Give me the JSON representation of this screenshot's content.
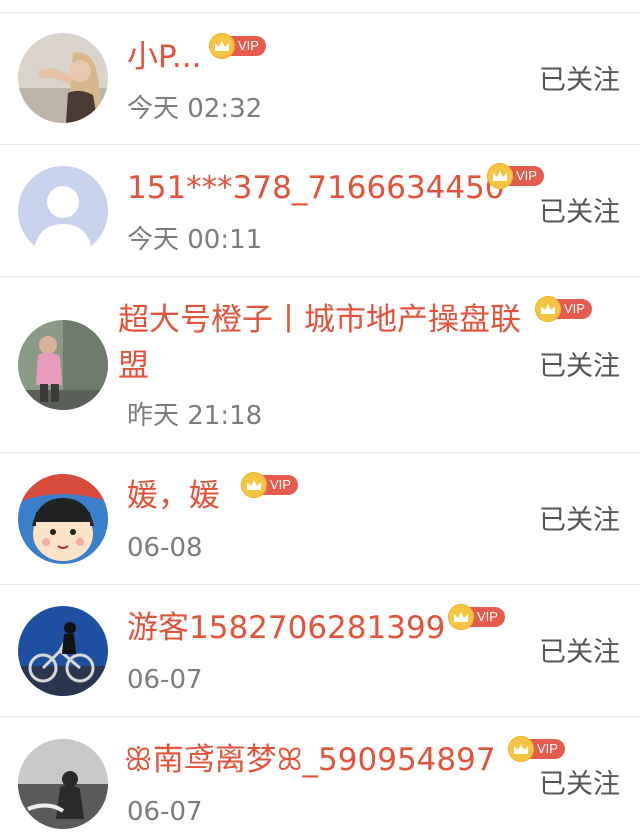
{
  "follow_list": [
    {
      "name": "小P...",
      "vip_label": "VIP",
      "time": "今天 02:32",
      "status": "已关注",
      "avatar": "avatar-girl-photo"
    },
    {
      "name": "151***378_7166634450",
      "vip_label": "VIP",
      "time": "今天 00:11",
      "status": "已关注",
      "avatar": "default-user-icon"
    },
    {
      "name": "超大号橙子丨城市地产操盘联盟",
      "vip_label": "VIP",
      "time": "昨天 21:18",
      "status": "已关注",
      "avatar": "avatar-woman-photo"
    },
    {
      "name": "媛，媛",
      "vip_label": "VIP",
      "time": "06-08",
      "status": "已关注",
      "avatar": "avatar-cartoon-girl"
    },
    {
      "name": "游客1582706281399",
      "vip_label": "VIP",
      "time": "06-07",
      "status": "已关注",
      "avatar": "avatar-bicycle-photo"
    },
    {
      "name": "ꕥ南鸢离梦ꕤ_590954897",
      "vip_label": "VIP",
      "time": "06-07",
      "status": "已关注",
      "avatar": "avatar-bw-photo"
    }
  ],
  "colors": {
    "name": "#e2533a",
    "vip": "#e55c4e",
    "crown": "#f7c544",
    "time": "#7d7d7d",
    "follow": "#555555"
  }
}
